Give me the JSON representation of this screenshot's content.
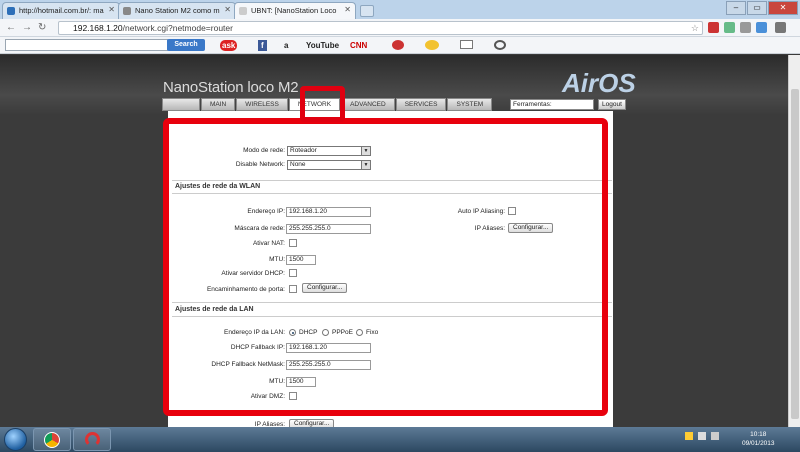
{
  "browser": {
    "tabs": [
      {
        "label": "http://hotmail.com.br/: ma"
      },
      {
        "label": "Nano Station M2 como m"
      },
      {
        "label": "UBNT: [NanoStation Loco"
      }
    ],
    "address_host": "192.168.1.20",
    "address_path": "/network.cgi?netmode=router",
    "window_buttons": {
      "minimize": "–",
      "maximize": "▭",
      "close": "✕"
    },
    "back_icon": "←",
    "forward_icon": "→",
    "reload_icon": "↻",
    "star": "☆"
  },
  "toolbar": {
    "search_button": "Search",
    "items": [
      "ask",
      "f",
      "a",
      "YouTube",
      "CNN"
    ]
  },
  "device": {
    "brand": "NanoStation loco M2",
    "logo": "AirOS",
    "tabs": [
      "MAIN",
      "WIRELESS",
      "NETWORK",
      "ADVANCED",
      "SERVICES",
      "SYSTEM"
    ],
    "tools_select": "Ferramentas:",
    "logout": "Logout"
  },
  "form": {
    "modo_label": "Modo de rede:",
    "modo_value": "Roteador",
    "disable_label": "Disable Network:",
    "disable_value": "None",
    "wlan_title": "Ajustes de rede da WLAN",
    "wlan_ip_label": "Endereço IP:",
    "wlan_ip": "192.168.1.20",
    "wlan_mask_label": "Máscara de rede:",
    "wlan_mask": "255.255.255.0",
    "nat_label": "Ativar NAT:",
    "mtu_label": "MTU:",
    "mtu_value": "1500",
    "dhcp_srv_label": "Ativar servidor DHCP:",
    "portfwd_label": "Encaminhamento de porta:",
    "configurar": "Configurar...",
    "auto_alias_label": "Auto IP Aliasing:",
    "ip_aliases_label": "IP Aliases:",
    "lan_title": "Ajustes de rede da LAN",
    "lan_ip_label": "Endereço IP da LAN:",
    "opt_dhcp": "DHCP",
    "opt_pppoe": "PPPoE",
    "opt_fixo": "Fixo",
    "fb_ip_label": "DHCP Fallback IP:",
    "fb_ip": "192.168.1.20",
    "fb_mask_label": "DHCP Fallback NetMask:",
    "fb_mask": "255.255.255.0",
    "lan_mtu_label": "MTU:",
    "lan_mtu": "1500",
    "dmz_label": "Ativar DMZ:",
    "lan_aliases_label": "IP Aliases:"
  },
  "taskbar": {
    "time": "10:18",
    "date": "09/01/2013"
  },
  "colors": {
    "highlight": "#e8000d",
    "chrome_tabs": "#bcd3ea"
  }
}
